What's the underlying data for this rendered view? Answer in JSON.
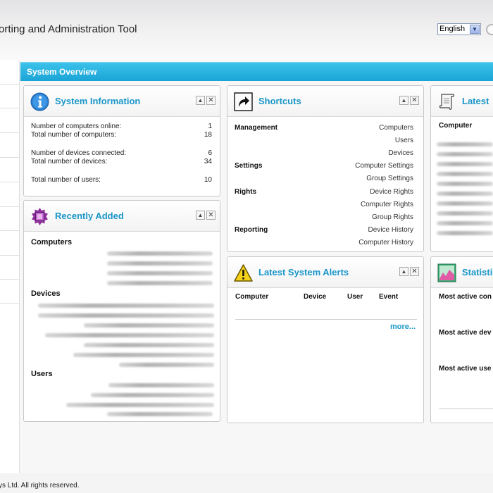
{
  "app": {
    "title": "orting and Administration Tool",
    "language": "English",
    "copyright": "ys Ltd. All rights reserved."
  },
  "section": {
    "title": "System Overview"
  },
  "system_information": {
    "title": "System Information",
    "rows": [
      {
        "label": "Number of computers online:",
        "value": "1"
      },
      {
        "label": "Total number of computers:",
        "value": "18"
      },
      {
        "label": "Number of devices connected:",
        "value": "6"
      },
      {
        "label": "Total number of devices:",
        "value": "34"
      },
      {
        "label": "Total number of users:",
        "value": "10"
      }
    ]
  },
  "recently_added": {
    "title": "Recently Added",
    "groups": [
      "Computers",
      "Devices",
      "Users"
    ]
  },
  "shortcuts": {
    "title": "Shortcuts",
    "groups": [
      {
        "label": "Management",
        "links": [
          "Computers",
          "Users",
          "Devices"
        ]
      },
      {
        "label": "Settings",
        "links": [
          "Computer Settings",
          "Group Settings"
        ]
      },
      {
        "label": "Rights",
        "links": [
          "Device Rights",
          "Computer Rights",
          "Group Rights"
        ]
      },
      {
        "label": "Reporting",
        "links": [
          "Device History",
          "Computer History"
        ]
      }
    ]
  },
  "alerts": {
    "title": "Latest System Alerts",
    "columns": [
      "Computer",
      "Device",
      "User",
      "Event"
    ],
    "more": "more..."
  },
  "latest": {
    "title": "Latest",
    "column": "Computer"
  },
  "statistics": {
    "title": "Statisti",
    "rows": [
      "Most active con",
      "Most active dev",
      "Most active use"
    ]
  },
  "colors": {
    "accent": "#1996c8",
    "section_bar": "#1aa4d6"
  },
  "icons": {
    "system_information": "info-icon",
    "recently_added": "chip-icon",
    "shortcuts": "shortcut-arrow-icon",
    "alerts": "warning-icon",
    "latest": "scroll-icon",
    "statistics": "chart-icon"
  }
}
